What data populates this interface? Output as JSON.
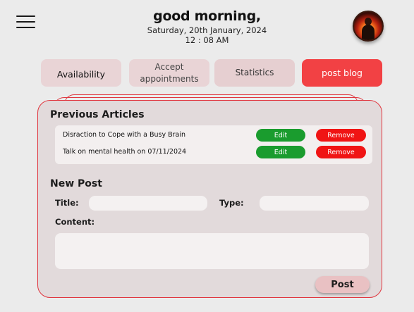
{
  "header": {
    "greeting": "good morning,",
    "date": "Saturday, 20th January, 2024",
    "time": "12 : 08 AM"
  },
  "icons": {
    "menu": "hamburger-menu-icon",
    "avatar": "user-avatar"
  },
  "tabs": [
    {
      "label": "Availability"
    },
    {
      "label": "Accept appointments"
    },
    {
      "label": "Statistics"
    },
    {
      "label": "post blog",
      "active": true
    }
  ],
  "previous_articles": {
    "title": "Previous Articles",
    "items": [
      {
        "title": "Disraction to Cope with a Busy Brain",
        "edit_label": "Edit",
        "remove_label": "Remove"
      },
      {
        "title": "Talk on mental health on 07/11/2024",
        "edit_label": "Edit",
        "remove_label": "Remove"
      }
    ]
  },
  "new_post": {
    "title": "New Post",
    "title_label": "Title:",
    "title_value": "",
    "type_label": "Type:",
    "type_value": "",
    "content_label": "Content:",
    "content_value": "",
    "submit_label": "Post"
  },
  "colors": {
    "background": "#ebebeb",
    "accent_red": "#f24144",
    "card_border": "#e0353e",
    "edit_green": "#1a9c2e",
    "remove_red": "#f01414",
    "tab_inactive": "#e9d4d6"
  }
}
